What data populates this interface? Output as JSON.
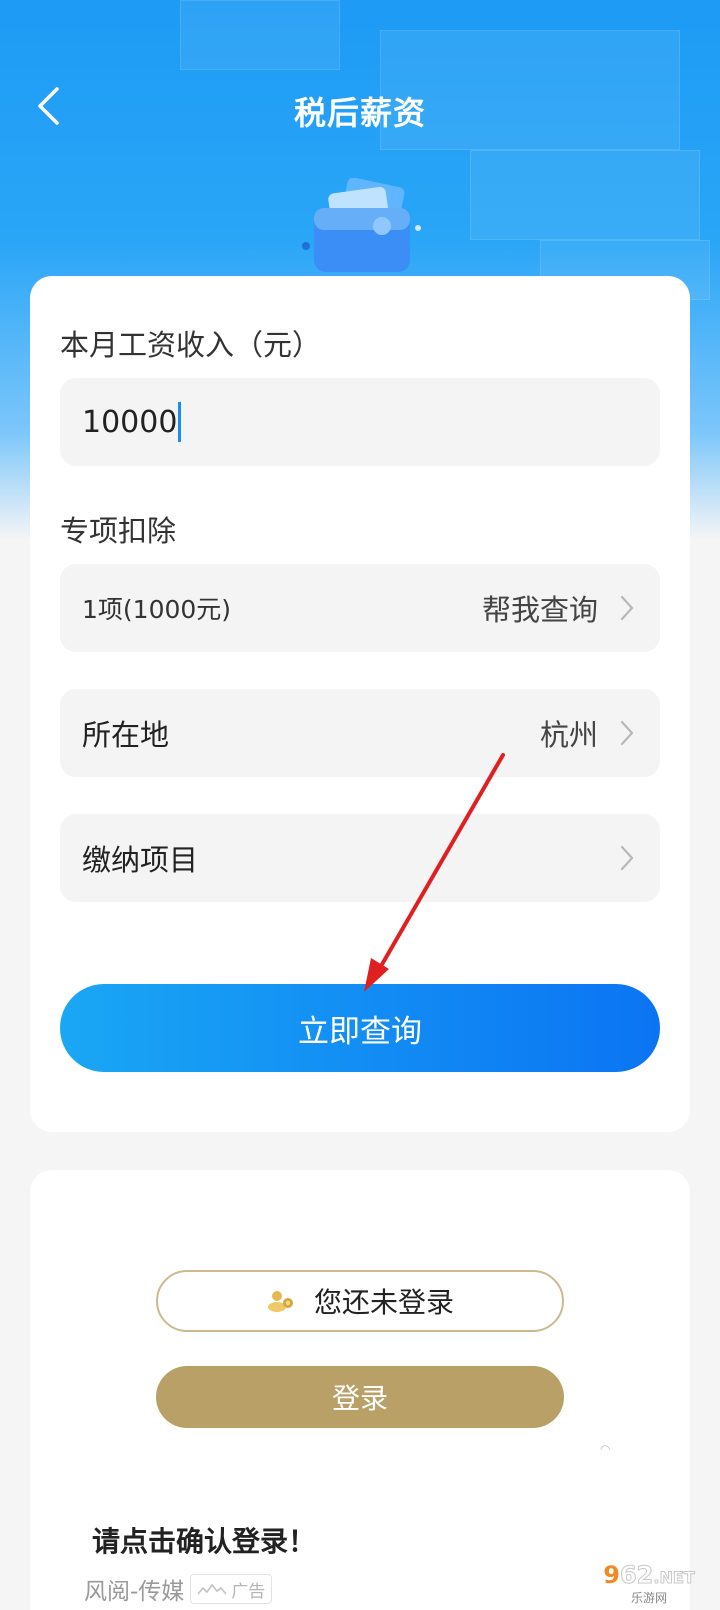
{
  "header": {
    "title": "税后薪资"
  },
  "salary": {
    "label": "本月工资收入（元）",
    "value": "10000"
  },
  "deduction": {
    "label": "专项扣除",
    "summary": "1项(1000元)",
    "action": "帮我查询"
  },
  "location": {
    "label": "所在地",
    "value": "杭州"
  },
  "payment": {
    "label": "缴纳项目"
  },
  "query_button": {
    "label": "立即查询"
  },
  "login_card": {
    "status": "您还未登录",
    "login_button": "登录",
    "prompt": "请点击确认登录！",
    "source": "风阅-传媒",
    "ad_label": "广告"
  },
  "watermark": {
    "top_accent": "9",
    "top_rest": "62",
    "top_suffix": ".NET",
    "bottom": "乐游网"
  },
  "colors": {
    "primary": "#1a8cf2",
    "gold": "#b9a067",
    "annotation_arrow": "#e02020"
  }
}
